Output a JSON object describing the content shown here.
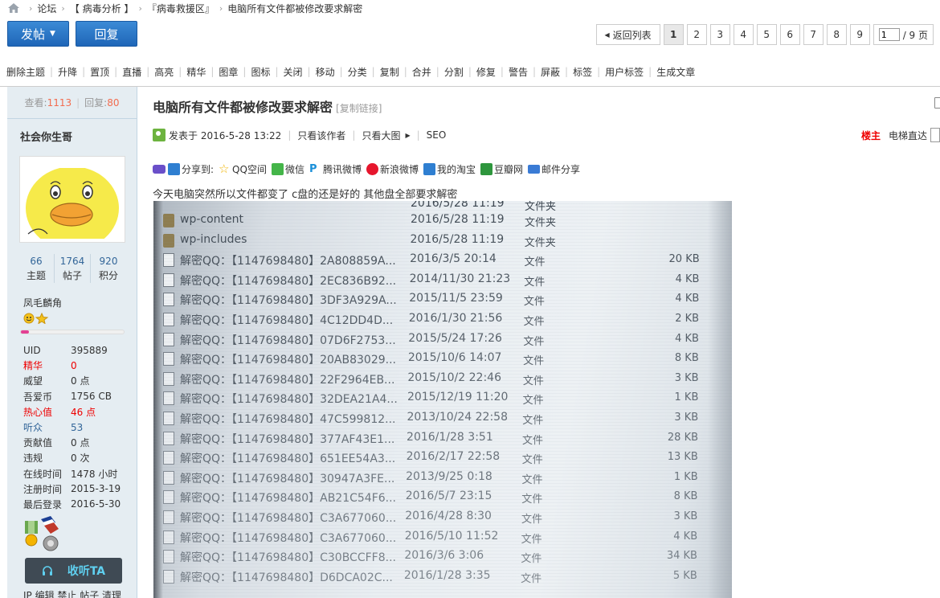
{
  "breadcrumb": [
    "论坛",
    "【 病毒分析 】",
    "『病毒救援区』",
    "电脑所有文件都被修改要求解密"
  ],
  "actions": {
    "post": "发帖",
    "reply": "回复"
  },
  "pagination": {
    "back": "返回列表",
    "pages": [
      "1",
      "2",
      "3",
      "4",
      "5",
      "6",
      "7",
      "8",
      "9"
    ],
    "current": "1",
    "jump_value": "1",
    "total": "/ 9 页"
  },
  "mod_tools": [
    "删除主题",
    "升降",
    "置顶",
    "直播",
    "高亮",
    "精华",
    "图章",
    "图标",
    "关闭",
    "移动",
    "分类",
    "复制",
    "合并",
    "分割",
    "修复",
    "警告",
    "屏蔽",
    "标签",
    "用户标签",
    "生成文章"
  ],
  "thread_stats": {
    "views_label": "查看:",
    "views": "1113",
    "replies_label": "回复:",
    "replies": "80"
  },
  "author": {
    "name": "社会你生哥",
    "counts": [
      {
        "value": "66",
        "label": "主题"
      },
      {
        "value": "1764",
        "label": "帖子"
      },
      {
        "value": "920",
        "label": "积分"
      }
    ],
    "group": "凤毛麟角",
    "level_progress": 0.08,
    "profile": [
      {
        "key": "UID",
        "value": "395889",
        "style": ""
      },
      {
        "key": "精华",
        "value": "0",
        "style": "red"
      },
      {
        "key": "威望",
        "value": "0 点",
        "style": ""
      },
      {
        "key": "吾爱币",
        "value": "1756 CB",
        "style": ""
      },
      {
        "key": "热心值",
        "value": "46 点",
        "style": "red"
      },
      {
        "key": "听众",
        "value": "53",
        "style": "blue"
      },
      {
        "key": "贡献值",
        "value": "0 点",
        "style": ""
      },
      {
        "key": "违规",
        "value": "0 次",
        "style": ""
      },
      {
        "key": "在线时间",
        "value": "1478 小时",
        "style": ""
      },
      {
        "key": "注册时间",
        "value": "2015-3-19",
        "style": ""
      },
      {
        "key": "最后登录",
        "value": "2016-5-30",
        "style": ""
      }
    ],
    "follow_button": "收听TA",
    "admin_links": "IP 编辑 禁止 帖子 清理"
  },
  "post": {
    "title": "电脑所有文件都被修改要求解密",
    "copy_link": "[复制链接]",
    "published": "发表于 2016-5-28 13:22",
    "only_author": "只看该作者",
    "only_images": "只看大图",
    "seo": "SEO",
    "floor": "楼主",
    "elevator": "电梯直达",
    "share_label": "分享到:",
    "share": [
      "QQ空间",
      "微信",
      "腾讯微博",
      "新浪微博",
      "我的淘宝",
      "豆瓣网",
      "邮件分享"
    ],
    "body": "今天电脑突然所以文件都变了 c盘的还是好的  其他盘全部要求解密"
  },
  "photo_rows": [
    {
      "kind": "folder",
      "name": "wp-content",
      "date": "2016/5/28 11:19",
      "type": "文件夹",
      "size": ""
    },
    {
      "kind": "folder",
      "name": "wp-includes",
      "date": "2016/5/28 11:19",
      "type": "文件夹",
      "size": ""
    },
    {
      "kind": "doc",
      "name": "解密QQ：【1147698480】2A808859A...",
      "date": "2016/3/5 20:14",
      "type": "文件",
      "size": "20 KB"
    },
    {
      "kind": "doc",
      "name": "解密QQ：【1147698480】2EC836B92...",
      "date": "2014/11/30 21:23",
      "type": "文件",
      "size": "4 KB"
    },
    {
      "kind": "doc",
      "name": "解密QQ：【1147698480】3DF3A929A...",
      "date": "2015/11/5 23:59",
      "type": "文件",
      "size": "4 KB"
    },
    {
      "kind": "doc",
      "name": "解密QQ：【1147698480】4C12DD4D...",
      "date": "2016/1/30 21:56",
      "type": "文件",
      "size": "2 KB"
    },
    {
      "kind": "doc",
      "name": "解密QQ：【1147698480】07D6F2753...",
      "date": "2015/5/24 17:26",
      "type": "文件",
      "size": "4 KB"
    },
    {
      "kind": "doc",
      "name": "解密QQ：【1147698480】20AB83029...",
      "date": "2015/10/6 14:07",
      "type": "文件",
      "size": "8 KB"
    },
    {
      "kind": "doc",
      "name": "解密QQ：【1147698480】22F2964EB...",
      "date": "2015/10/2 22:46",
      "type": "文件",
      "size": "3 KB"
    },
    {
      "kind": "doc",
      "name": "解密QQ：【1147698480】32DEA21A4...",
      "date": "2015/12/19 11:20",
      "type": "文件",
      "size": "1 KB"
    },
    {
      "kind": "doc",
      "name": "解密QQ：【1147698480】47C599812...",
      "date": "2013/10/24 22:58",
      "type": "文件",
      "size": "3 KB"
    },
    {
      "kind": "doc",
      "name": "解密QQ：【1147698480】377AF43E1...",
      "date": "2016/1/28 3:51",
      "type": "文件",
      "size": "28 KB"
    },
    {
      "kind": "doc",
      "name": "解密QQ：【1147698480】651EE54A3...",
      "date": "2016/2/17 22:58",
      "type": "文件",
      "size": "13 KB"
    },
    {
      "kind": "doc",
      "name": "解密QQ：【1147698480】30947A3FE...",
      "date": "2013/9/25 0:18",
      "type": "文件",
      "size": "1 KB"
    },
    {
      "kind": "doc",
      "name": "解密QQ：【1147698480】AB21C54F6...",
      "date": "2016/5/7 23:15",
      "type": "文件",
      "size": "8 KB"
    },
    {
      "kind": "doc",
      "name": "解密QQ：【1147698480】C3A677060...",
      "date": "2016/4/28 8:30",
      "type": "文件",
      "size": "3 KB"
    },
    {
      "kind": "doc",
      "name": "解密QQ：【1147698480】C3A677060...",
      "date": "2016/5/10 11:52",
      "type": "文件",
      "size": "4 KB"
    },
    {
      "kind": "doc",
      "name": "解密QQ：【1147698480】C30BCCFF8...",
      "date": "2016/3/6 3:06",
      "type": "文件",
      "size": "34 KB"
    },
    {
      "kind": "doc",
      "name": "解密QQ：【1147698480】D6DCA02C...",
      "date": "2016/1/28 3:35",
      "type": "文件",
      "size": "5 KB"
    }
  ],
  "colors": {
    "primary_button": "#1f66b8",
    "sidebar_bg": "#e5edf2",
    "stat_number": "#f26c4f",
    "floor_label": "#e00000"
  },
  "icons": [
    "home-icon",
    "caret-down-icon",
    "back-arrow-icon",
    "headphones-icon",
    "online-status-icon",
    "print-icon"
  ]
}
